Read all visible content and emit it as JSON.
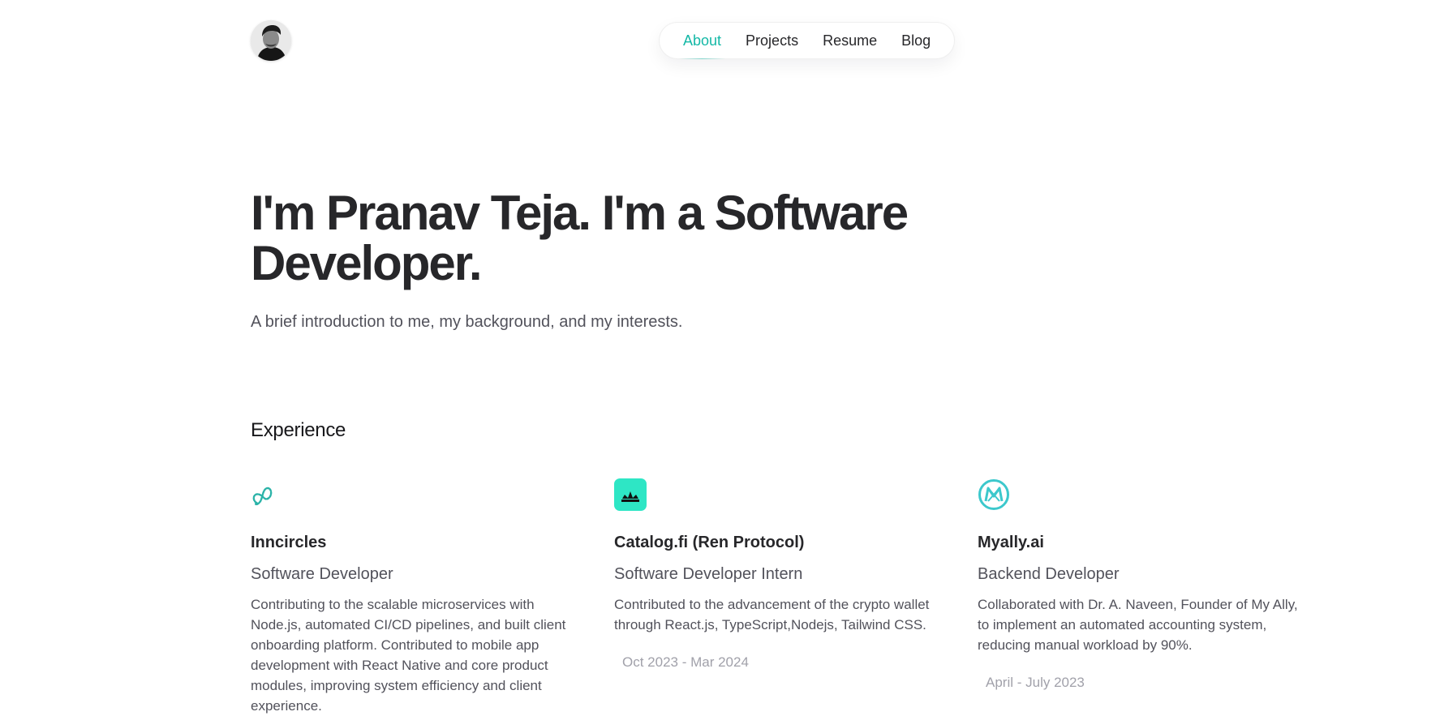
{
  "header": {
    "avatar_alt": "Profile photo",
    "nav": [
      {
        "label": "About",
        "active": true
      },
      {
        "label": "Projects",
        "active": false
      },
      {
        "label": "Resume",
        "active": false
      },
      {
        "label": "Blog",
        "active": false
      }
    ]
  },
  "hero": {
    "title": "I'm Pranav Teja. I'm a Software Developer.",
    "subtitle": "A brief introduction to me, my background, and my interests."
  },
  "experience": {
    "heading": "Experience",
    "items": [
      {
        "icon": "infinity-icon",
        "company": "Inncircles",
        "role": "Software Developer",
        "description": "Contributing to the scalable microservices with Node.js, automated CI/CD pipelines, and built client onboarding platform. Contributed to mobile app development with React Native and core product modules, improving system efficiency and client experience.",
        "dates": ""
      },
      {
        "icon": "catalog-crown-icon",
        "company": "Catalog.fi (Ren Protocol)",
        "role": "Software Developer Intern",
        "description": "Contributed to the advancement of the crypto wallet through React.js, TypeScript,Nodejs, Tailwind CSS.",
        "dates": "Oct 2023 - Mar 2024"
      },
      {
        "icon": "myally-m-icon",
        "company": "Myally.ai",
        "role": "Backend Developer",
        "description": "Collaborated with Dr. A. Naveen, Founder of My Ally, to implement an automated accounting system, reducing manual workload by 90%.",
        "dates": "April - July 2023"
      }
    ]
  },
  "colors": {
    "accent": "#14b8a6",
    "text": "#27272a",
    "muted": "#52525b",
    "dates": "#a1a1aa",
    "catalog_logo_bg": "#2ee6c5",
    "myally_logo": "#3cc8cc"
  }
}
